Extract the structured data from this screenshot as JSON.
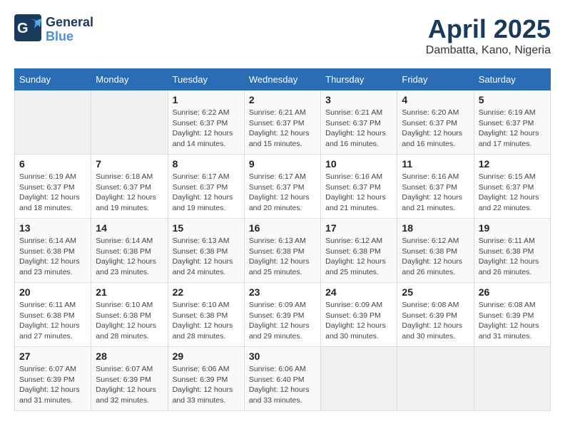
{
  "logo": {
    "line1": "General",
    "line2": "Blue",
    "bird": "🐦"
  },
  "title": "April 2025",
  "location": "Dambatta, Kano, Nigeria",
  "weekdays": [
    "Sunday",
    "Monday",
    "Tuesday",
    "Wednesday",
    "Thursday",
    "Friday",
    "Saturday"
  ],
  "weeks": [
    [
      {
        "day": "",
        "info": ""
      },
      {
        "day": "",
        "info": ""
      },
      {
        "day": "1",
        "info": "Sunrise: 6:22 AM\nSunset: 6:37 PM\nDaylight: 12 hours\nand 14 minutes."
      },
      {
        "day": "2",
        "info": "Sunrise: 6:21 AM\nSunset: 6:37 PM\nDaylight: 12 hours\nand 15 minutes."
      },
      {
        "day": "3",
        "info": "Sunrise: 6:21 AM\nSunset: 6:37 PM\nDaylight: 12 hours\nand 16 minutes."
      },
      {
        "day": "4",
        "info": "Sunrise: 6:20 AM\nSunset: 6:37 PM\nDaylight: 12 hours\nand 16 minutes."
      },
      {
        "day": "5",
        "info": "Sunrise: 6:19 AM\nSunset: 6:37 PM\nDaylight: 12 hours\nand 17 minutes."
      }
    ],
    [
      {
        "day": "6",
        "info": "Sunrise: 6:19 AM\nSunset: 6:37 PM\nDaylight: 12 hours\nand 18 minutes."
      },
      {
        "day": "7",
        "info": "Sunrise: 6:18 AM\nSunset: 6:37 PM\nDaylight: 12 hours\nand 19 minutes."
      },
      {
        "day": "8",
        "info": "Sunrise: 6:17 AM\nSunset: 6:37 PM\nDaylight: 12 hours\nand 19 minutes."
      },
      {
        "day": "9",
        "info": "Sunrise: 6:17 AM\nSunset: 6:37 PM\nDaylight: 12 hours\nand 20 minutes."
      },
      {
        "day": "10",
        "info": "Sunrise: 6:16 AM\nSunset: 6:37 PM\nDaylight: 12 hours\nand 21 minutes."
      },
      {
        "day": "11",
        "info": "Sunrise: 6:16 AM\nSunset: 6:37 PM\nDaylight: 12 hours\nand 21 minutes."
      },
      {
        "day": "12",
        "info": "Sunrise: 6:15 AM\nSunset: 6:37 PM\nDaylight: 12 hours\nand 22 minutes."
      }
    ],
    [
      {
        "day": "13",
        "info": "Sunrise: 6:14 AM\nSunset: 6:38 PM\nDaylight: 12 hours\nand 23 minutes."
      },
      {
        "day": "14",
        "info": "Sunrise: 6:14 AM\nSunset: 6:38 PM\nDaylight: 12 hours\nand 23 minutes."
      },
      {
        "day": "15",
        "info": "Sunrise: 6:13 AM\nSunset: 6:38 PM\nDaylight: 12 hours\nand 24 minutes."
      },
      {
        "day": "16",
        "info": "Sunrise: 6:13 AM\nSunset: 6:38 PM\nDaylight: 12 hours\nand 25 minutes."
      },
      {
        "day": "17",
        "info": "Sunrise: 6:12 AM\nSunset: 6:38 PM\nDaylight: 12 hours\nand 25 minutes."
      },
      {
        "day": "18",
        "info": "Sunrise: 6:12 AM\nSunset: 6:38 PM\nDaylight: 12 hours\nand 26 minutes."
      },
      {
        "day": "19",
        "info": "Sunrise: 6:11 AM\nSunset: 6:38 PM\nDaylight: 12 hours\nand 26 minutes."
      }
    ],
    [
      {
        "day": "20",
        "info": "Sunrise: 6:11 AM\nSunset: 6:38 PM\nDaylight: 12 hours\nand 27 minutes."
      },
      {
        "day": "21",
        "info": "Sunrise: 6:10 AM\nSunset: 6:38 PM\nDaylight: 12 hours\nand 28 minutes."
      },
      {
        "day": "22",
        "info": "Sunrise: 6:10 AM\nSunset: 6:38 PM\nDaylight: 12 hours\nand 28 minutes."
      },
      {
        "day": "23",
        "info": "Sunrise: 6:09 AM\nSunset: 6:39 PM\nDaylight: 12 hours\nand 29 minutes."
      },
      {
        "day": "24",
        "info": "Sunrise: 6:09 AM\nSunset: 6:39 PM\nDaylight: 12 hours\nand 30 minutes."
      },
      {
        "day": "25",
        "info": "Sunrise: 6:08 AM\nSunset: 6:39 PM\nDaylight: 12 hours\nand 30 minutes."
      },
      {
        "day": "26",
        "info": "Sunrise: 6:08 AM\nSunset: 6:39 PM\nDaylight: 12 hours\nand 31 minutes."
      }
    ],
    [
      {
        "day": "27",
        "info": "Sunrise: 6:07 AM\nSunset: 6:39 PM\nDaylight: 12 hours\nand 31 minutes."
      },
      {
        "day": "28",
        "info": "Sunrise: 6:07 AM\nSunset: 6:39 PM\nDaylight: 12 hours\nand 32 minutes."
      },
      {
        "day": "29",
        "info": "Sunrise: 6:06 AM\nSunset: 6:39 PM\nDaylight: 12 hours\nand 33 minutes."
      },
      {
        "day": "30",
        "info": "Sunrise: 6:06 AM\nSunset: 6:40 PM\nDaylight: 12 hours\nand 33 minutes."
      },
      {
        "day": "",
        "info": ""
      },
      {
        "day": "",
        "info": ""
      },
      {
        "day": "",
        "info": ""
      }
    ]
  ]
}
